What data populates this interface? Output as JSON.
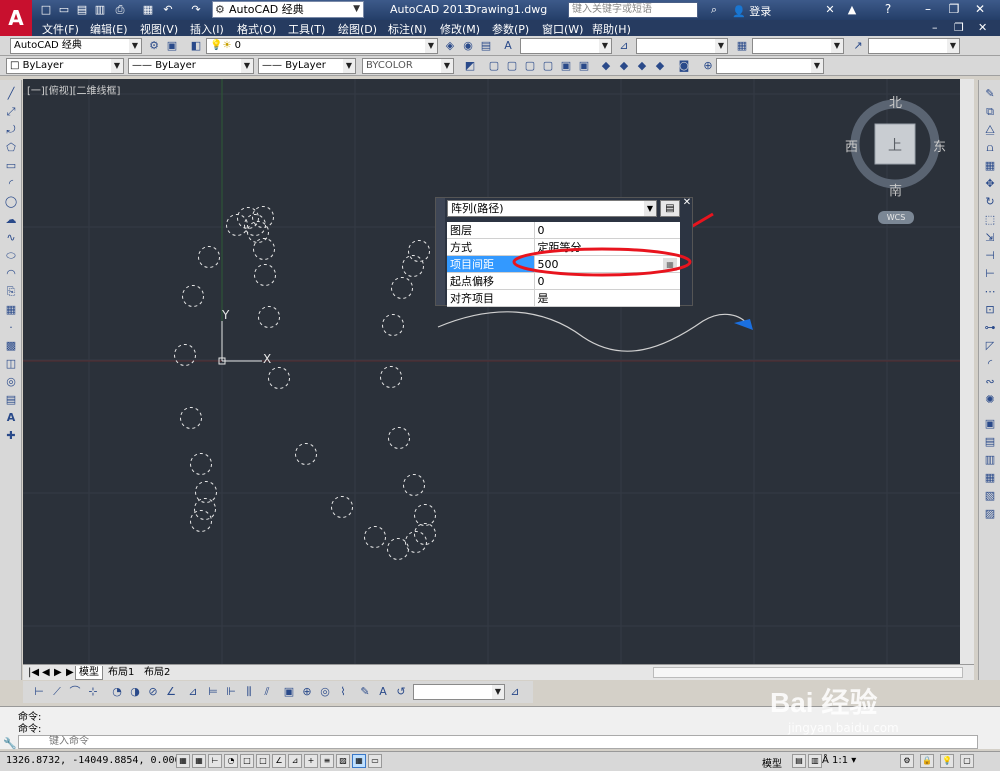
{
  "title_bar": {
    "workspace": "AutoCAD 经典",
    "app_title": "AutoCAD 2013",
    "file_name": "Drawing1.dwg",
    "search_placeholder": "键入关键字或短语",
    "login": "登录"
  },
  "menu": [
    "文件(F)",
    "编辑(E)",
    "视图(V)",
    "插入(I)",
    "格式(O)",
    "工具(T)",
    "绘图(D)",
    "标注(N)",
    "修改(M)",
    "参数(P)",
    "窗口(W)",
    "帮助(H)"
  ],
  "toolbar": {
    "workspace_combo": "AutoCAD 经典",
    "layer_combo": "0",
    "color_combo": "ByLayer",
    "linetype_combo": "ByLayer",
    "lineweight_combo": "ByLayer",
    "plotstyle_combo": "BYCOLOR"
  },
  "canvas": {
    "view_label": "[一][俯视][二维线框]",
    "ucs_y": "Y",
    "ucs_x": "X",
    "background": "#2b313a"
  },
  "viewcube": {
    "north": "北",
    "south": "南",
    "east": "东",
    "west": "西",
    "face": "上",
    "wcs": "WCS"
  },
  "properties": {
    "selector": "阵列(路径)",
    "rows": [
      {
        "key": "图层",
        "value": "0"
      },
      {
        "key": "方式",
        "value": "定距等分"
      },
      {
        "key": "项目间距",
        "value": "500"
      },
      {
        "key": "起点偏移",
        "value": "0"
      },
      {
        "key": "对齐项目",
        "value": "是"
      }
    ],
    "selected_key": "项目间距"
  },
  "tabs": [
    "模型",
    "布局1",
    "布局2"
  ],
  "command": {
    "history1": "命令:",
    "history2": "命令:",
    "placeholder": "键入命令"
  },
  "status": {
    "coordinates": "1326.8732,  -14049.8854, 0.0000",
    "model": "模型",
    "scale": "1:1"
  },
  "watermark": {
    "main": "Bai 经验",
    "sub": "jingyan.baidu.com"
  },
  "colors": {
    "annotation_red": "#e8141e",
    "selection_blue": "#3399ff",
    "grip_blue": "#1a6fe0",
    "dash_circle": "#e6e6e6"
  }
}
